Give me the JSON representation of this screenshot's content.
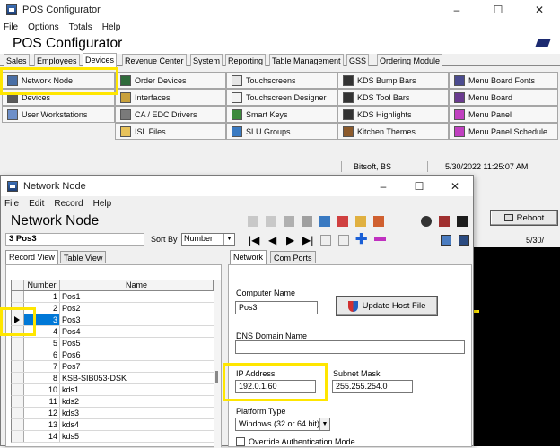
{
  "back_window": {
    "title": "POS Configurator",
    "window_buttons": [
      "–",
      "☐",
      "✕"
    ],
    "menu": [
      "File",
      "Options",
      "Totals",
      "Help"
    ],
    "app_title": "POS Configurator",
    "tabs": [
      "Sales",
      "Employees",
      "Devices",
      "Revenue Center",
      "System",
      "Reporting",
      "Table Management",
      "GSS",
      "Ordering Module"
    ],
    "active_tab": "Devices",
    "grid": [
      [
        "Network Node",
        "Order Devices",
        "Touchscreens",
        "KDS Bump Bars",
        "Menu Board Fonts"
      ],
      [
        "Devices",
        "Interfaces",
        "Touchscreen Designer",
        "KDS Tool Bars",
        "Menu Board"
      ],
      [
        "User Workstations",
        "CA / EDC Drivers",
        "Smart Keys",
        "KDS Highlights",
        "Menu Panel"
      ],
      [
        "",
        "ISL Files",
        "SLU Groups",
        "Kitchen Themes",
        "Menu Panel Schedule"
      ]
    ],
    "status_user": "Bitsoft, BS",
    "status_datetime": "5/30/2022 11:25:07 AM"
  },
  "background_right": {
    "reboot_label": "Reboot",
    "date_fragment": "5/30/"
  },
  "front_window": {
    "title": "Network Node",
    "window_buttons": [
      "–",
      "☐",
      "✕"
    ],
    "menu": [
      "File",
      "Edit",
      "Record",
      "Help"
    ],
    "app_title": "Network Node",
    "current_record": "3 Pos3",
    "sort_label": "Sort By",
    "sort_value": "Number",
    "nav_buttons": [
      "|◀",
      "◀",
      "▶",
      "▶|"
    ],
    "list_tabs": [
      "Record View",
      "Table View"
    ],
    "active_list_tab": "Record View",
    "columns": [
      "Number",
      "Name"
    ],
    "rows": [
      {
        "number": "1",
        "name": "Pos1"
      },
      {
        "number": "2",
        "name": "Pos2"
      },
      {
        "number": "3",
        "name": "Pos3"
      },
      {
        "number": "4",
        "name": "Pos4"
      },
      {
        "number": "5",
        "name": "Pos5"
      },
      {
        "number": "6",
        "name": "Pos6"
      },
      {
        "number": "7",
        "name": "Pos7"
      },
      {
        "number": "8",
        "name": "KSB-SIB053-DSK"
      },
      {
        "number": "10",
        "name": "kds1"
      },
      {
        "number": "11",
        "name": "kds2"
      },
      {
        "number": "12",
        "name": "kds3"
      },
      {
        "number": "13",
        "name": "kds4"
      },
      {
        "number": "14",
        "name": "kds5"
      }
    ],
    "selected_row": 2,
    "detail_tabs": [
      "Network",
      "Com Ports"
    ],
    "active_detail_tab": "Network",
    "computer_name_label": "Computer Name",
    "computer_name_value": "Pos3",
    "update_host_label": "Update Host File",
    "dns_label": "DNS Domain Name",
    "dns_value": "",
    "ip_label": "IP Address",
    "ip_value": "192.0.1.60",
    "subnet_label": "Subnet Mask",
    "subnet_value": "255.255.254.0",
    "platform_label": "Platform Type",
    "platform_value": "Windows (32 or 64 bit)",
    "override_label": "Override Authentication Mode"
  },
  "colors": {
    "highlight": "#ffe600",
    "selection": "#0078d7",
    "window_bg": "#f0f0f0"
  }
}
